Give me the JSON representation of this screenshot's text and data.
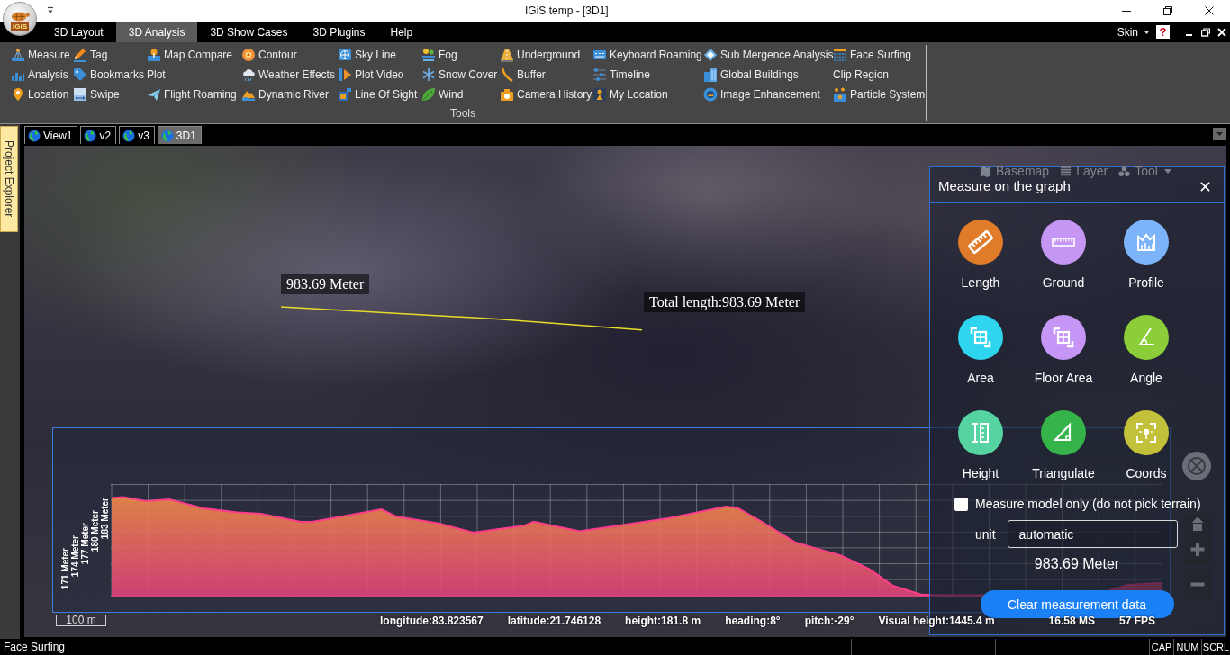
{
  "window": {
    "title": "IGiS temp - [3D1]",
    "logo_text": "IGiS"
  },
  "menu_bar": {
    "tabs": [
      {
        "label": "3D Layout",
        "selected": false
      },
      {
        "label": "3D Analysis",
        "selected": true
      },
      {
        "label": "3D Show Cases",
        "selected": false
      },
      {
        "label": "3D Plugins",
        "selected": false
      },
      {
        "label": "Help",
        "selected": false
      }
    ],
    "skin": "Skin",
    "help": "?"
  },
  "ribbon": {
    "columns": [
      {
        "items": [
          "Measure",
          "Analysis",
          "Location"
        ]
      },
      {
        "items": [
          "Tag",
          "Bookmarks",
          "Swipe"
        ]
      },
      {
        "items": [
          "Map Compare",
          "Plot",
          "Flight Roaming"
        ]
      },
      {
        "items": [
          "Contour",
          "Weather Effects",
          "Dynamic River"
        ]
      },
      {
        "items": [
          "Sky Line",
          "Plot Video",
          "Line Of Sight"
        ]
      },
      {
        "items": [
          "Fog",
          "Snow Cover",
          "Wind"
        ]
      },
      {
        "items": [
          "Underground",
          "Buffer",
          "Camera History"
        ]
      },
      {
        "items": [
          "Keyboard Roaming",
          "Timeline",
          "My Location"
        ]
      },
      {
        "items": [
          "Sub Mergence Analysis",
          "Global Buildings",
          "Image Enhancement"
        ]
      },
      {
        "items": [
          "Face Surfing",
          "Clip Region",
          "Particle System"
        ]
      }
    ],
    "group_label": "Tools"
  },
  "side_tab": "Project Explorer",
  "view_tabs": [
    {
      "label": "View1",
      "selected": false
    },
    {
      "label": "v2",
      "selected": false
    },
    {
      "label": "v3",
      "selected": false
    },
    {
      "label": "3D1",
      "selected": true
    }
  ],
  "map": {
    "labels": [
      "983.69 Meter",
      "Total length:983.69 Meter"
    ],
    "toolbar": [
      "Basemap",
      "Layer",
      "Tool"
    ],
    "profile": {
      "y_labels": [
        "171 Meter",
        "174 Meter",
        "177 Meter",
        "180 Meter",
        "183 Meter"
      ]
    },
    "scale": "100 m",
    "readouts": [
      "longitude:83.823567",
      "latitude:21.746128",
      "height:181.8 m",
      "heading:8°",
      "pitch:-29°",
      "Visual height:1445.4 m",
      "16.58 MS",
      "57 FPS"
    ]
  },
  "measure_panel": {
    "title": "Measure on the graph",
    "tools": [
      {
        "label": "Length",
        "color": "#e07b29"
      },
      {
        "label": "Ground",
        "color": "#c596f3"
      },
      {
        "label": "Profile",
        "color": "#7db3f8"
      },
      {
        "label": "Area",
        "color": "#2fd5ef"
      },
      {
        "label": "Floor Area",
        "color": "#c596f5"
      },
      {
        "label": "Angle",
        "color": "#8ccd3a"
      },
      {
        "label": "Height",
        "color": "#55d3a0"
      },
      {
        "label": "Triangulate",
        "color": "#35b44a"
      },
      {
        "label": "Coords",
        "color": "#c3c13a"
      }
    ],
    "model_only": {
      "label": "Measure model only (do not pick terrain)",
      "checked": false
    },
    "unit": {
      "label": "unit",
      "value": "automatic"
    },
    "result": "983.69 Meter",
    "clear_button": "Clear measurement data"
  },
  "status_bar": {
    "message": "Face Surfing",
    "indicators": [
      "CAP",
      "NUM",
      "SCRL"
    ]
  }
}
